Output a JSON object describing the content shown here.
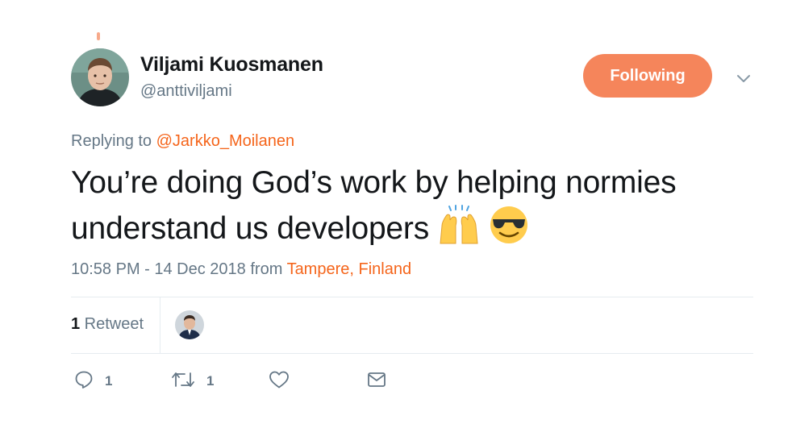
{
  "author": {
    "name": "Viljami Kuosmanen",
    "handle": "@anttiviljami",
    "avatar_icon": "profile-photo"
  },
  "follow_button": {
    "label": "Following",
    "color": "#f5855b"
  },
  "reply": {
    "prefix": "Replying to ",
    "mention": "@Jarkko_Moilanen"
  },
  "tweet": {
    "text": "You’re doing God’s work by helping normies understand us developers",
    "emojis": [
      "raising-hands-emoji",
      "sunglasses-face-emoji"
    ]
  },
  "meta": {
    "time_date": "10:58 PM - 14 Dec 2018 from ",
    "location": "Tampere, Finland"
  },
  "stats": {
    "retweet_count": "1",
    "retweet_label": " Retweet"
  },
  "actions": {
    "reply_count": "1",
    "retweet_count": "1",
    "like_count": "",
    "icons": [
      "reply-icon",
      "retweet-icon",
      "like-icon",
      "message-icon"
    ]
  },
  "colors": {
    "accent": "#f5651b",
    "text": "#14171a",
    "secondary": "#657786",
    "divider": "#e6ecf0"
  }
}
